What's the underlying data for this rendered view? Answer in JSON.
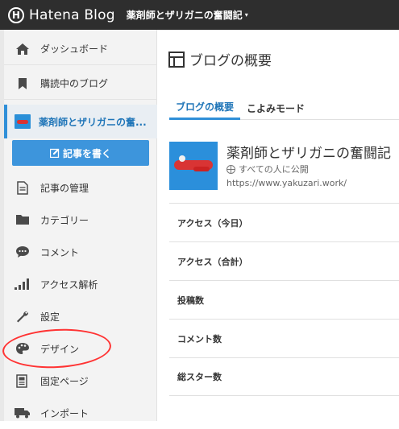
{
  "topbar": {
    "brand_letter": "H",
    "brand_name": "Hatena Blog",
    "blog_name": "薬剤師とザリガニの奮闘記",
    "caret": "▾"
  },
  "sidebar": {
    "dashboard": "ダッシュボード",
    "subscribed": "購読中のブログ",
    "current_blog": "薬剤師とザリガニの奮...",
    "write": "記事を書く",
    "manage_posts": "記事の管理",
    "category": "カテゴリー",
    "comment": "コメント",
    "analytics": "アクセス解析",
    "settings": "設定",
    "design": "デザイン",
    "static_page": "固定ページ",
    "import": "インポート"
  },
  "main": {
    "title": "ブログの概要",
    "tabs": [
      "ブログの概要",
      "こよみモード"
    ],
    "blog": {
      "name": "薬剤師とザリガニの奮闘記",
      "visibility": "すべての人に公開",
      "url": "https://www.yakuzari.work/"
    },
    "stats": [
      "アクセス（今日）",
      "アクセス（合計）",
      "投稿数",
      "コメント数",
      "総スター数"
    ]
  },
  "colors": {
    "topbar": "#2e2e2e",
    "accent": "#2f8fd8",
    "write_button": "#3d95dc",
    "annotation": "#ff3333"
  },
  "icons": {
    "dashboard": "home-icon",
    "subscribed": "bookmark-icon",
    "manage_posts": "document-icon",
    "category": "folder-icon",
    "comment": "comment-icon",
    "analytics": "bar-chart-icon",
    "settings": "wrench-icon",
    "design": "palette-icon",
    "static_page": "page-icon",
    "import": "truck-icon"
  }
}
